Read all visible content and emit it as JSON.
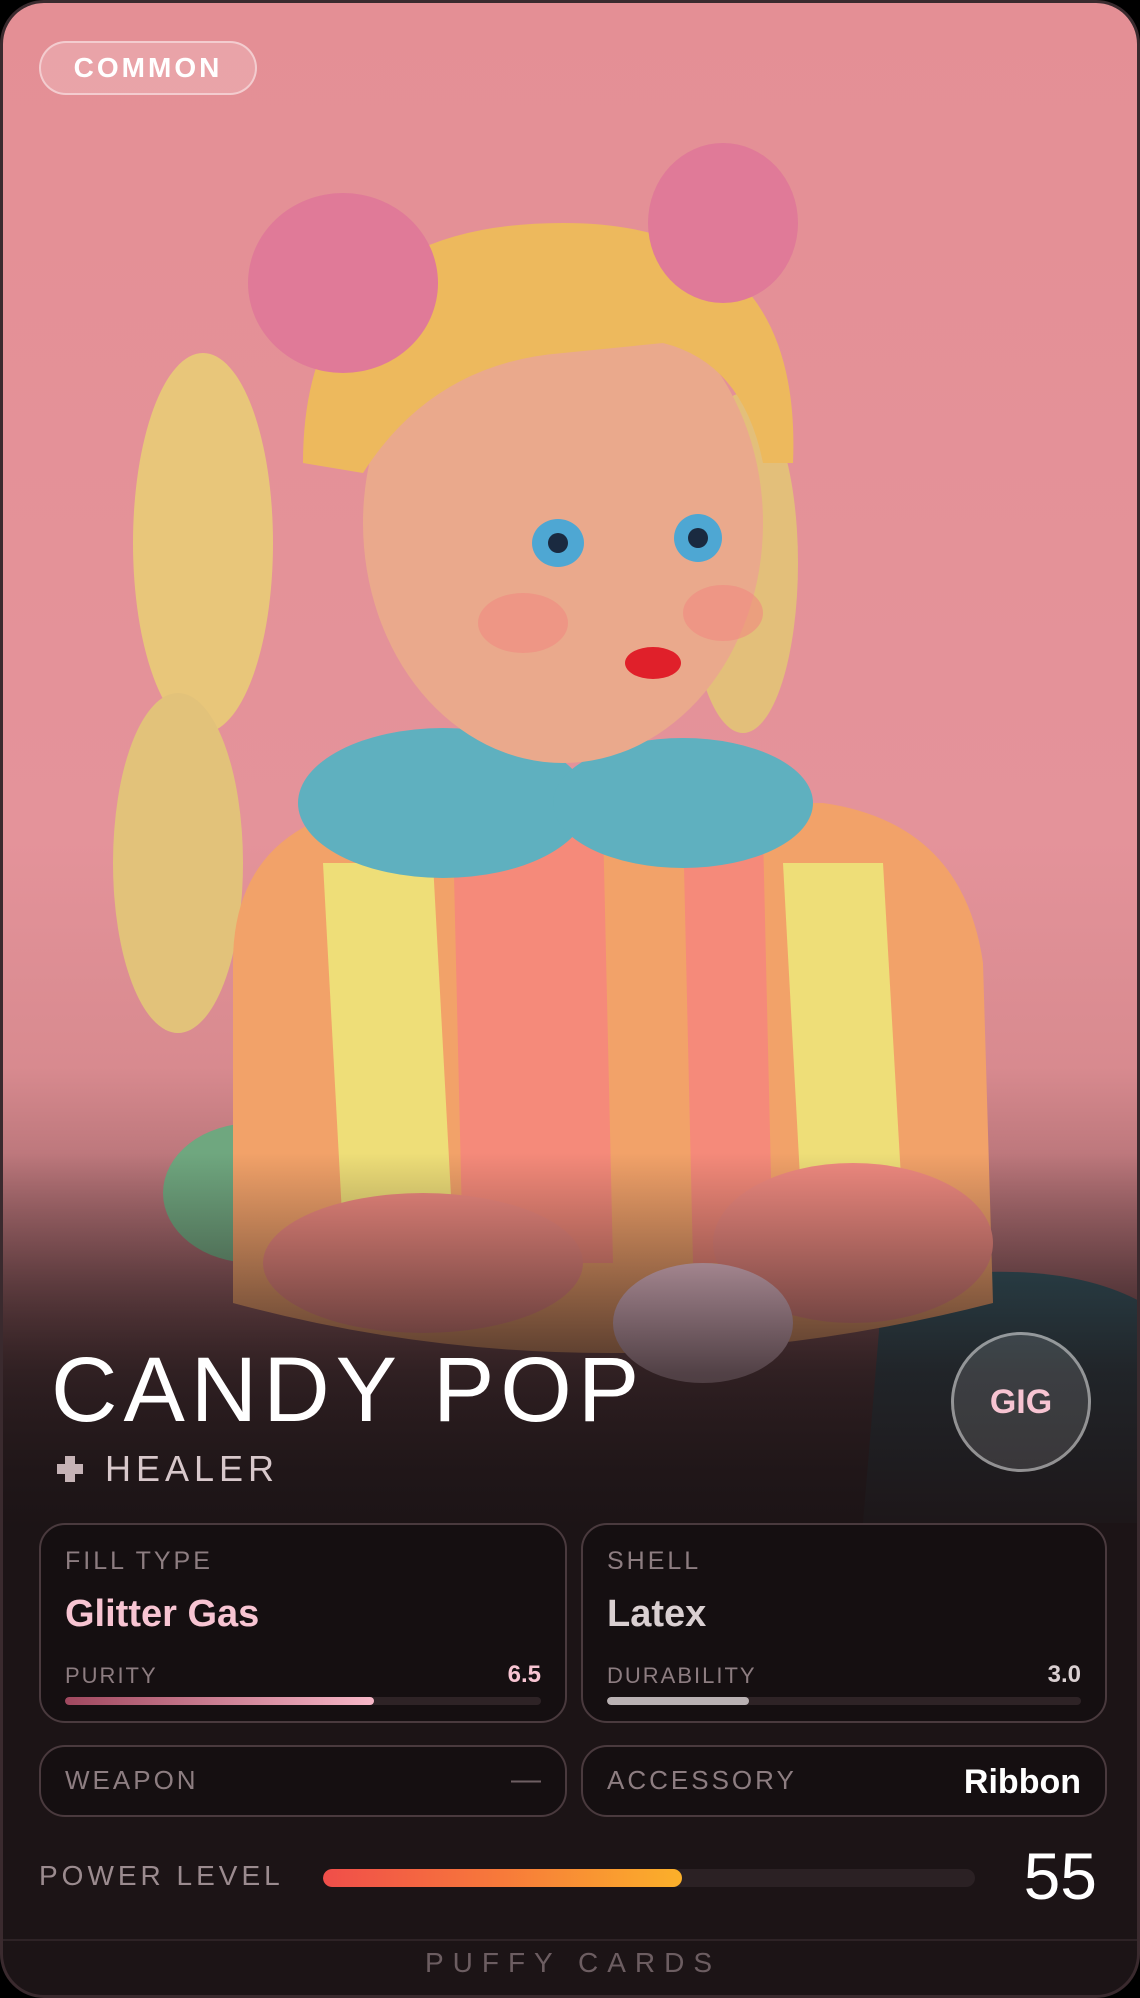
{
  "card": {
    "rarity": "COMMON",
    "name": "CANDY POP",
    "role_icon": "plus-icon",
    "role": "HEALER",
    "badge": "GIG",
    "colors": {
      "accent_pink": "#f7c4d2",
      "background": "#e48f95",
      "panel_border": "#4a3a3e"
    }
  },
  "stats": {
    "fill": {
      "label": "FILL TYPE",
      "value": "Glitter Gas",
      "sub_label": "PURITY",
      "sub_value": "6.5",
      "level": 0.65,
      "value_color": "#f7c4d2",
      "bar_gradient": [
        "#a0485f",
        "#f7b7c8"
      ]
    },
    "shell": {
      "label": "SHELL",
      "value": "Latex",
      "sub_label": "DURABILITY",
      "sub_value": "3.0",
      "level": 0.3,
      "value_color": "#d9cfd1",
      "bar_gradient": [
        "#a9a1a3",
        "#c9c1c3"
      ]
    }
  },
  "slots": {
    "weapon": {
      "label": "WEAPON",
      "value": "—"
    },
    "accessory": {
      "label": "ACCESSORY",
      "value": "Ribbon"
    }
  },
  "power": {
    "label": "POWER LEVEL",
    "value": "55",
    "level": 0.55
  },
  "footer": "PUFFY CARDS"
}
